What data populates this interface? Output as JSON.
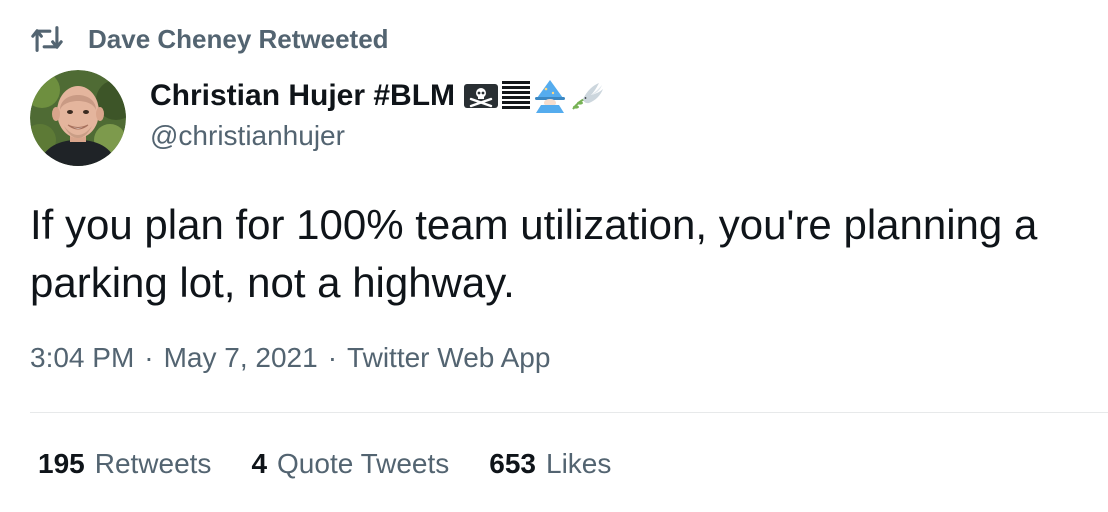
{
  "retweet_header": {
    "icon": "retweet-icon",
    "text": "Dave Cheney Retweeted"
  },
  "author": {
    "display_name": "Christian Hujer #BLM",
    "handle": "@christianhujer",
    "name_emojis": [
      "pirate-flag-icon",
      "text-lines-icon",
      "mage-icon",
      "dove-icon"
    ],
    "avatar": "avatar-photo"
  },
  "tweet": {
    "text": "If you plan for 100% team utilization, you're planning a parking lot, not a highway."
  },
  "meta": {
    "time": "3:04 PM",
    "separator": "·",
    "date": "May 7, 2021",
    "client": "Twitter Web App"
  },
  "stats": [
    {
      "count": "195",
      "label": "Retweets"
    },
    {
      "count": "4",
      "label": "Quote Tweets"
    },
    {
      "count": "653",
      "label": "Likes"
    }
  ],
  "colors": {
    "text_primary": "#0f1419",
    "text_secondary": "#536471",
    "divider": "#e7e9ea",
    "background": "#ffffff"
  }
}
